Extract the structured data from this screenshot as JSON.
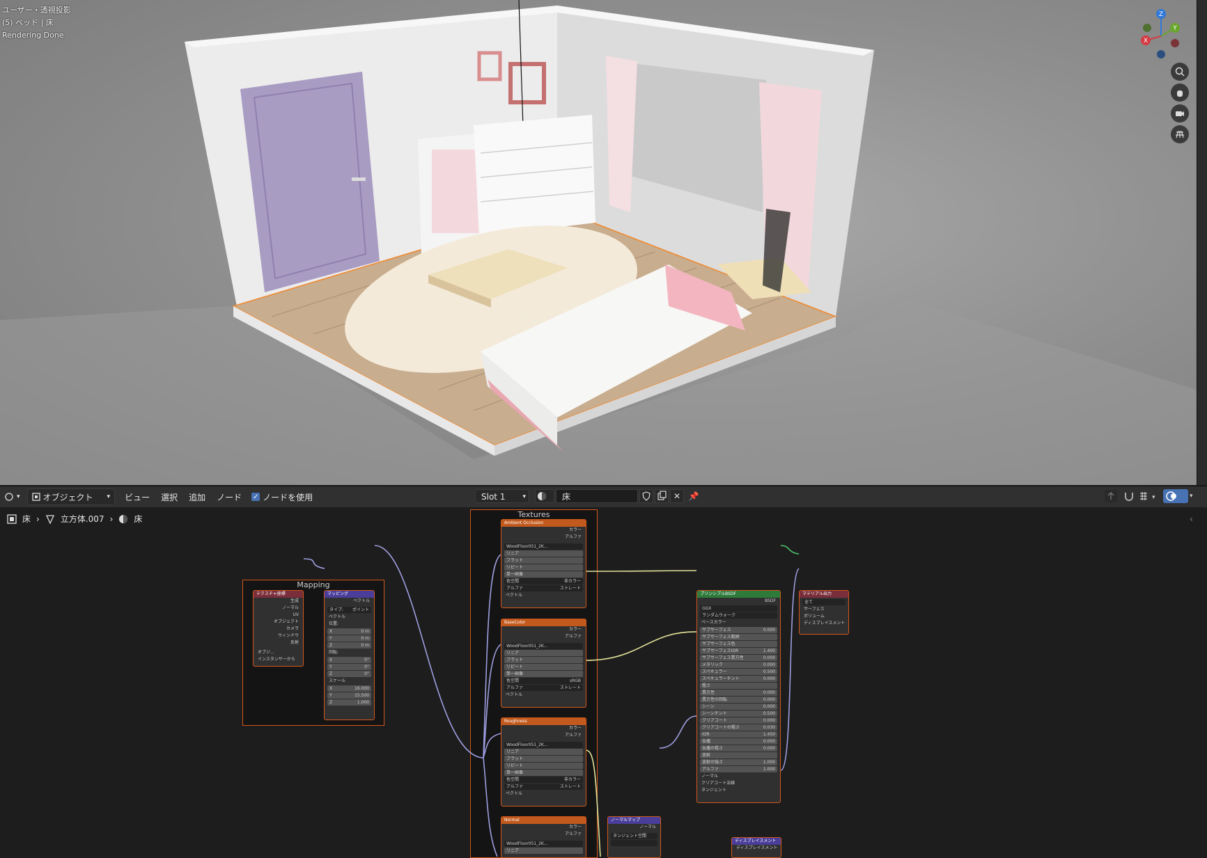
{
  "viewport": {
    "info_line1": "ユーザー・透視投影",
    "info_line2": "(5) ベッド | 床",
    "info_line3": "Rendering Done",
    "gizmo": {
      "z": "Z",
      "y": "Y",
      "x": "X"
    }
  },
  "header": {
    "mode": "オブジェクト",
    "menu": [
      "ビュー",
      "選択",
      "追加",
      "ノード"
    ],
    "use_nodes_label": "ノードを使用",
    "slot": "Slot 1",
    "material_name": "床"
  },
  "breadcrumb": {
    "object": "床",
    "mesh": "立方体.007",
    "material": "床"
  },
  "frames": {
    "mapping": "Mapping",
    "textures": "Textures"
  },
  "nodes": {
    "texcoord": {
      "title": "テクスチャ座標",
      "outputs": [
        "生成",
        "ノーマル",
        "UV",
        "オブジェクト",
        "カメラ",
        "ウィンドウ",
        "反射"
      ],
      "object_label": "オブジ...",
      "instancer": "インスタンサーから"
    },
    "mapping": {
      "title": "マッピング",
      "out": "ベクトル",
      "type_label": "タイプ:",
      "type_value": "ポイント",
      "vector": "ベクトル",
      "location": "位置:",
      "loc": [
        [
          "X",
          "0 m"
        ],
        [
          "Y",
          "0 m"
        ],
        [
          "Z",
          "0 m"
        ]
      ],
      "rotation": "回転:",
      "rot": [
        [
          "X",
          "0°"
        ],
        [
          "Y",
          "0°"
        ],
        [
          "Z",
          "0°"
        ]
      ],
      "scale": "スケール",
      "scl": [
        [
          "X",
          "16.000"
        ],
        [
          "Y",
          "15.500"
        ],
        [
          "Z",
          "1.000"
        ]
      ]
    },
    "textures": [
      {
        "title": "Ambient Occlusion",
        "file": "WoodFloor051_2K...",
        "colorspace": "非カラー",
        "alpha": "ストレート"
      },
      {
        "title": "BaseColor",
        "file": "WoodFloor051_2K...",
        "colorspace": "sRGB",
        "alpha": "ストレート"
      },
      {
        "title": "Roughness",
        "file": "WoodFloor051_2K...",
        "colorspace": "非カラー",
        "alpha": "ストレート"
      },
      {
        "title": "Normal",
        "file": "WoodFloor051_2K...",
        "colorspace": "",
        "alpha": ""
      }
    ],
    "tex_common": {
      "out_color": "カラー",
      "out_alpha": "アルファ",
      "interp": "リニア",
      "proj": "フラット",
      "ext": "リピート",
      "src": "単一画像",
      "cs_label": "色空間",
      "alpha_label": "アルファ",
      "vector": "ベクトル"
    },
    "bsdf": {
      "title": "プリンシプルBSDF",
      "out": "BSDF",
      "dist": "GGX",
      "sss_method": "ランダムウォーク",
      "base_color": "ベースカラー",
      "params": [
        [
          "サブサーフェス",
          "0.000"
        ],
        [
          "サブサーフェス範囲",
          ""
        ],
        [
          "サブサーフェス色",
          ""
        ],
        [
          "サブサーフェスIOR",
          "1.400"
        ],
        [
          "サブサーフェス異方性",
          "0.000"
        ],
        [
          "メタリック",
          "0.000"
        ],
        [
          "スペキュラー",
          "0.500"
        ],
        [
          "スペキュラーチント",
          "0.000"
        ],
        [
          "粗さ",
          ""
        ],
        [
          "異方性",
          "0.000"
        ],
        [
          "異方性の回転",
          "0.000"
        ],
        [
          "シーン",
          "0.000"
        ],
        [
          "シーンチント",
          "0.500"
        ],
        [
          "クリアコート",
          "0.000"
        ],
        [
          "クリアコートの粗さ",
          "0.030"
        ],
        [
          "IOR",
          "1.450"
        ],
        [
          "伝播",
          "0.000"
        ],
        [
          "伝播の粗さ",
          "0.000"
        ],
        [
          "放射",
          ""
        ],
        [
          "放射の強さ",
          "1.000"
        ],
        [
          "アルファ",
          "1.000"
        ]
      ],
      "normal": "ノーマル",
      "cc_normal": "クリアコート法線",
      "tangent": "タンジェント"
    },
    "output": {
      "title": "マテリアル出力",
      "target": "全て",
      "surface": "サーフェス",
      "volume": "ボリューム",
      "disp": "ディスプレイスメント"
    },
    "normalmap": {
      "title": "ノーマルマップ",
      "out": "ノーマル",
      "space": "タンジェント空間"
    },
    "displacement": {
      "title": "ディスプレイスメント",
      "out": "ディスプレイスメント"
    }
  },
  "colors": {
    "frame_border": "#d3581b",
    "texture_header": "#c25a1e",
    "bsdf_header": "#2d7a3a",
    "output_header": "#7a2d3a",
    "vector_header": "#4a3e9a",
    "accent": "#4772b3"
  }
}
